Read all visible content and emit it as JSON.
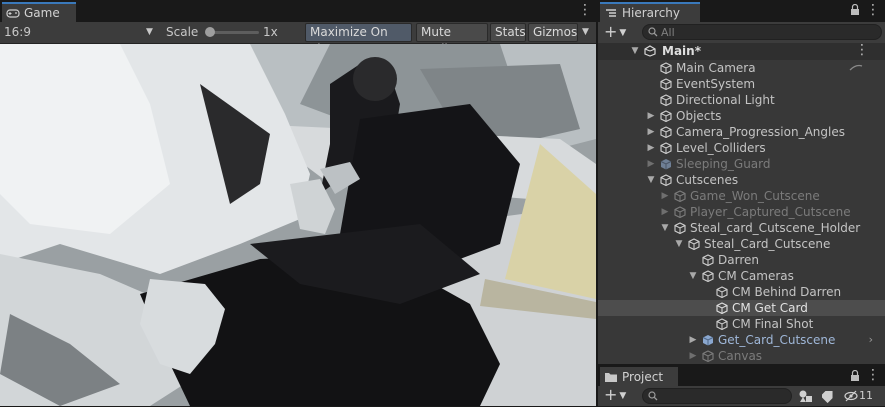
{
  "game": {
    "tab_label": "Game",
    "aspect": "16:9",
    "scale_label": "Scale",
    "scale_value": "1x",
    "buttons": {
      "maximize": "Maximize On Play",
      "mute": "Mute Audio",
      "stats": "Stats",
      "gizmos": "Gizmos"
    }
  },
  "hierarchy": {
    "tab_label": "Hierarchy",
    "search_placeholder": "All",
    "items": [
      {
        "label": "Main*"
      },
      {
        "label": "Main Camera"
      },
      {
        "label": "EventSystem"
      },
      {
        "label": "Directional Light"
      },
      {
        "label": "Objects"
      },
      {
        "label": "Camera_Progression_Angles"
      },
      {
        "label": "Level_Colliders"
      },
      {
        "label": "Sleeping_Guard"
      },
      {
        "label": "Cutscenes"
      },
      {
        "label": "Game_Won_Cutscene"
      },
      {
        "label": "Player_Captured_Cutscene"
      },
      {
        "label": "Steal_card_Cutscene_Holder"
      },
      {
        "label": "Steal_Card_Cutscene"
      },
      {
        "label": "Darren"
      },
      {
        "label": "CM Cameras"
      },
      {
        "label": "CM Behind Darren"
      },
      {
        "label": "CM Get Card"
      },
      {
        "label": "CM Final Shot"
      },
      {
        "label": "Get_Card_Cutscene"
      },
      {
        "label": "Canvas"
      }
    ]
  },
  "project": {
    "tab_label": "Project",
    "hidden_count": "11"
  },
  "colors": {
    "accent": "#3a79bb",
    "selected_row": "#4d4d4d"
  }
}
